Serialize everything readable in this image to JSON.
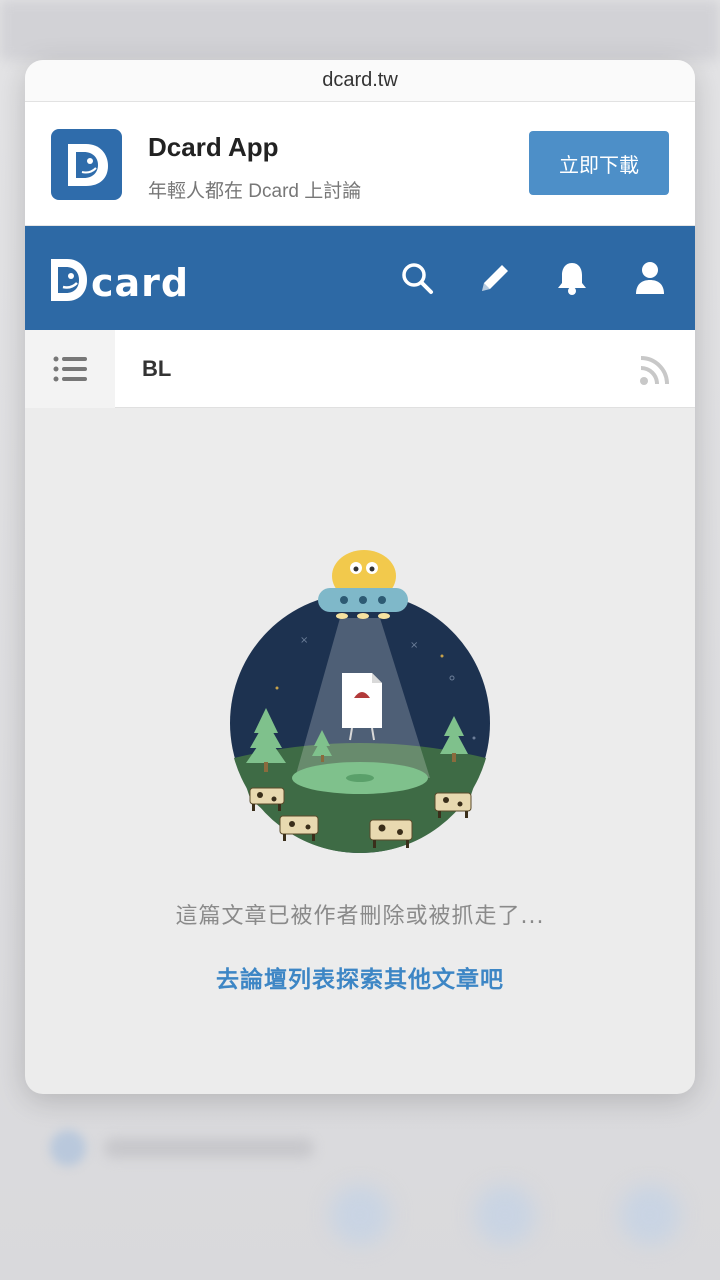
{
  "browser": {
    "url": "dcard.tw"
  },
  "app_banner": {
    "title": "Dcard App",
    "subtitle": "年輕人都在 Dcard 上討論",
    "download_label": "立即下載",
    "icon": "dcard-app-icon"
  },
  "navbar": {
    "logo_text": "card",
    "icons": [
      "search-icon",
      "pencil-icon",
      "bell-icon",
      "user-icon"
    ]
  },
  "subbar": {
    "forum_name": "BL",
    "icons": [
      "list-menu-icon",
      "rss-icon"
    ]
  },
  "content": {
    "message": "這篇文章已被作者刪除或被抓走了...",
    "link_text": "去論壇列表探索其他文章吧"
  },
  "colors": {
    "brand_blue": "#2d69a5",
    "button_blue": "#4d8fc8",
    "link_blue": "#3d86c5"
  }
}
